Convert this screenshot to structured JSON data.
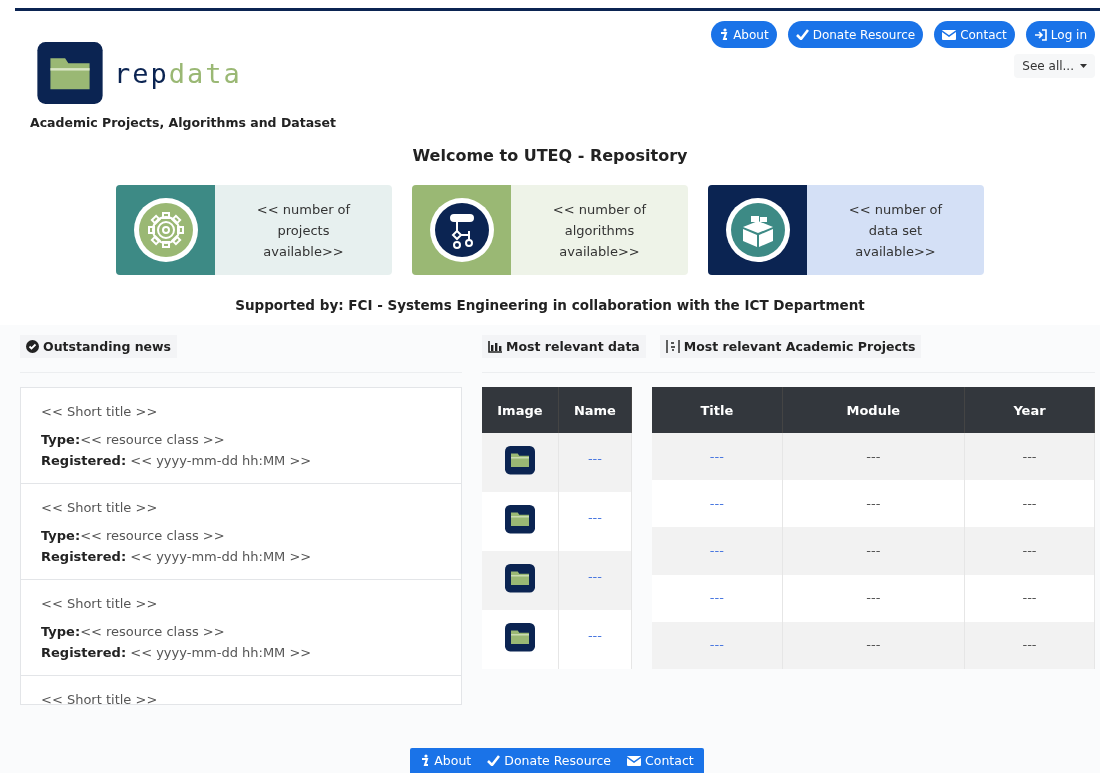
{
  "header": {
    "logo": {
      "parts": [
        "rep",
        "data"
      ]
    },
    "nav": [
      {
        "label": "About"
      },
      {
        "label": "Donate Resource"
      },
      {
        "label": "Contact"
      },
      {
        "label": "Log in"
      }
    ],
    "dropdown": "See all...",
    "subtitle": "Academic Projects, Algorithms and Dataset"
  },
  "welcome": {
    "title": "Welcome to UTEQ - Repository",
    "cards": [
      {
        "text": "<< number of projects available>>",
        "color": "#3d8a85"
      },
      {
        "text": "<< number of algorithms available>>",
        "color": "#9ab874"
      },
      {
        "text": "<< number of data set available>>",
        "color": "#0b2452"
      }
    ],
    "supported": "Supported by: FCI - Systems Engineering in collaboration with the ICT Department"
  },
  "news": {
    "heading": "Outstanding news",
    "items": [
      {
        "title": "<< Short title >>",
        "type_label": "Type:",
        "type": "<< resource class >>",
        "registered_label": "Registered:",
        "registered": "<< yyyy-mm-dd hh:MM >>"
      },
      {
        "title": "<< Short title >>",
        "type_label": "Type:",
        "type": "<< resource class >>",
        "registered_label": "Registered:",
        "registered": "<< yyyy-mm-dd hh:MM >>"
      },
      {
        "title": "<< Short title >>",
        "type_label": "Type:",
        "type": "<< resource class >>",
        "registered_label": "Registered:",
        "registered": "<< yyyy-mm-dd hh:MM >>"
      },
      {
        "title": "<< Short title >>"
      }
    ]
  },
  "data": {
    "heading": "Most relevant data",
    "columns": [
      "Image",
      "Name"
    ],
    "rows": [
      {
        "name": "---"
      },
      {
        "name": "---"
      },
      {
        "name": "---"
      },
      {
        "name": "---"
      }
    ]
  },
  "projects": {
    "heading": "Most relevant Academic Projects",
    "columns": [
      "Title",
      "Module",
      "Year"
    ],
    "rows": [
      {
        "title": "---",
        "module": "---",
        "year": "---"
      },
      {
        "title": "---",
        "module": "---",
        "year": "---"
      },
      {
        "title": "---",
        "module": "---",
        "year": "---"
      },
      {
        "title": "---",
        "module": "---",
        "year": "---"
      },
      {
        "title": "---",
        "module": "---",
        "year": "---"
      }
    ]
  },
  "footer": [
    {
      "label": "About"
    },
    {
      "label": "Donate Resource"
    },
    {
      "label": "Contact"
    }
  ]
}
